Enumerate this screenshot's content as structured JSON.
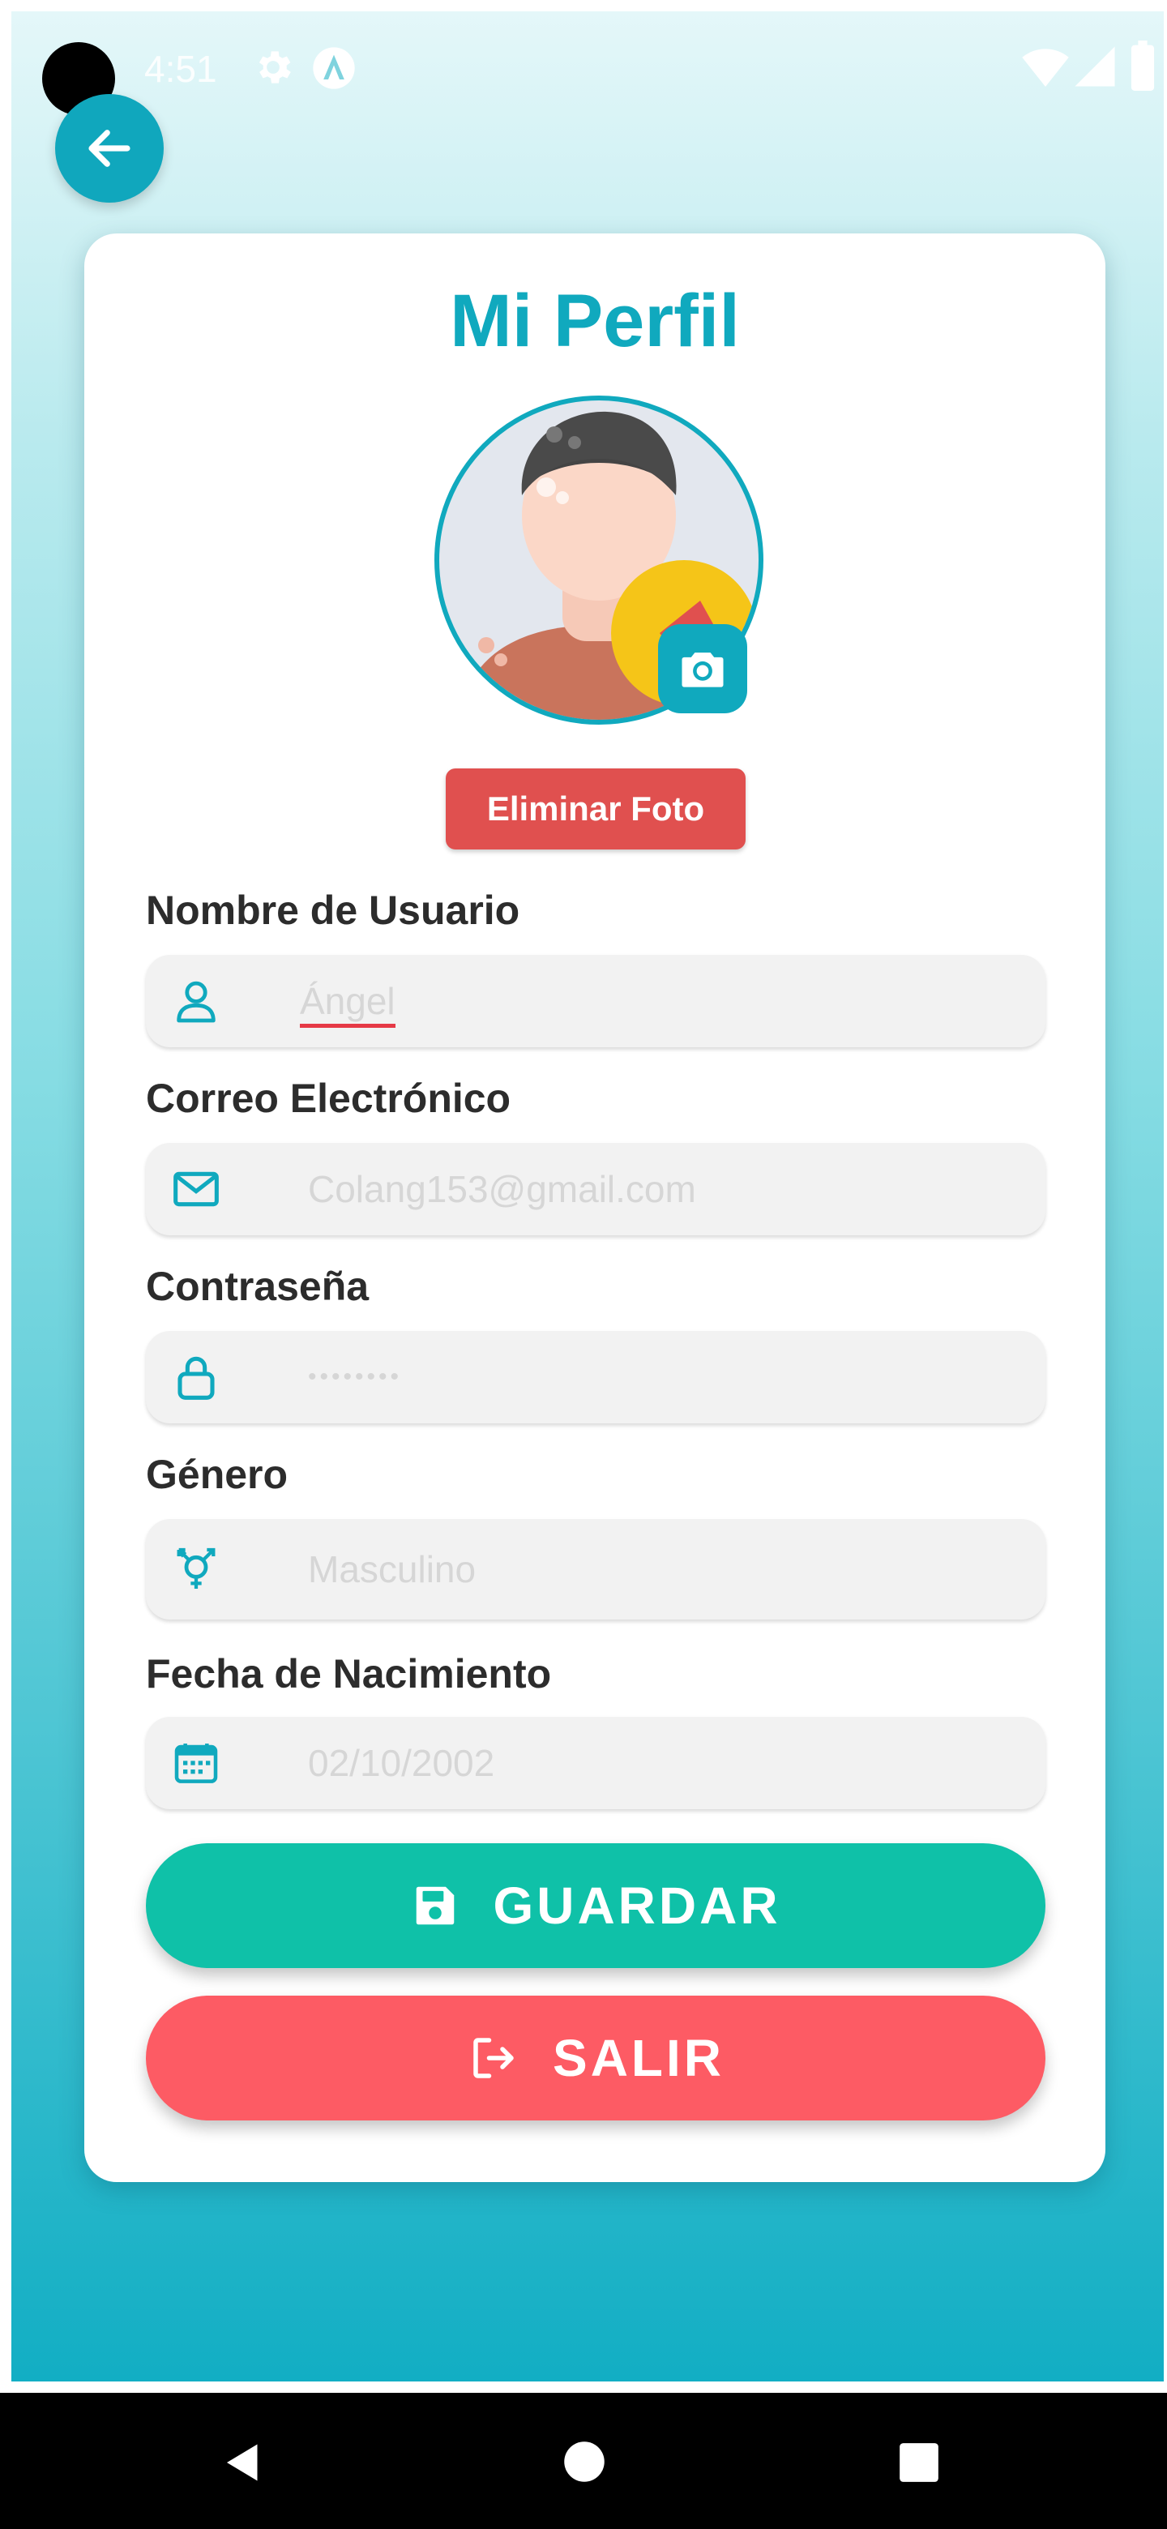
{
  "status_bar": {
    "time": "4:51"
  },
  "profile": {
    "title": "Mi Perfil",
    "delete_photo_label": "Eliminar Foto"
  },
  "fields": {
    "username": {
      "label": "Nombre de Usuario",
      "value": "Ángel",
      "icon": "user-icon"
    },
    "email": {
      "label": "Correo Electrónico",
      "value": "Colang153@gmail.com",
      "icon": "envelope-icon"
    },
    "password": {
      "label": "Contraseña",
      "value": "••••••••",
      "icon": "lock-icon"
    },
    "gender": {
      "label": "Género",
      "value": "Masculino",
      "icon": "gender-icon"
    },
    "birthdate": {
      "label": "Fecha de Nacimiento",
      "value": "02/10/2002",
      "icon": "calendar-icon"
    }
  },
  "actions": {
    "save_label": "GUARDAR",
    "exit_label": "SALIR"
  },
  "colors": {
    "accent": "#10a9be",
    "save": "#0fc1a8",
    "exit": "#fd5b64",
    "delete": "#e0504f"
  }
}
